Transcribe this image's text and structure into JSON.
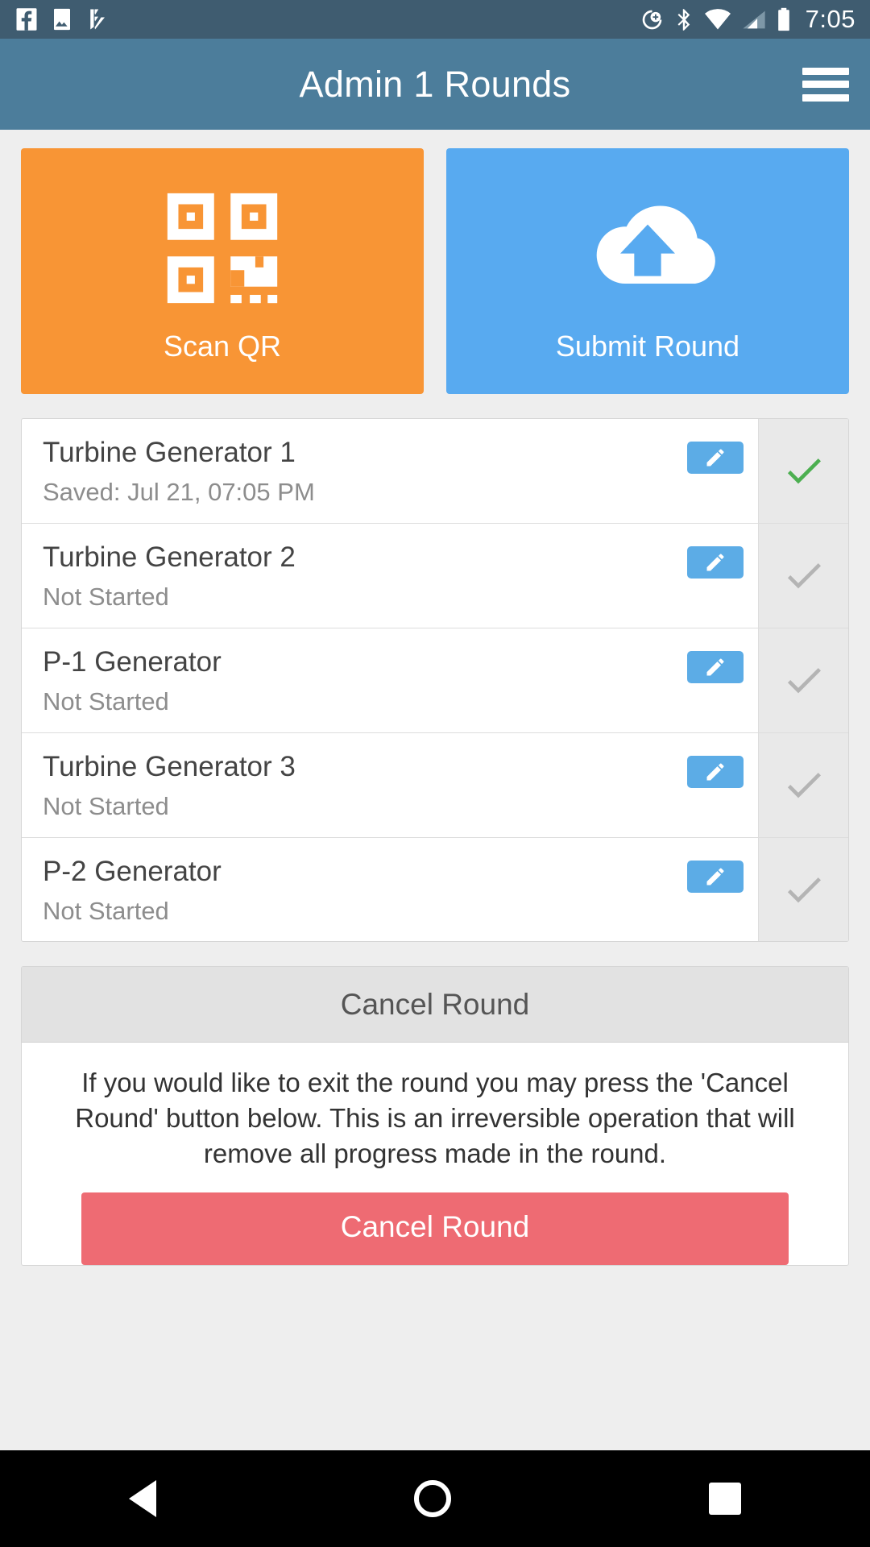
{
  "statusbar": {
    "time": "7:05",
    "left_icons": [
      "facebook-icon",
      "photos-icon",
      "checkmark-app-icon"
    ],
    "right_icons": [
      "location-add-icon",
      "bluetooth-icon",
      "wifi-icon",
      "cellular-signal-icon",
      "battery-icon"
    ],
    "bg_color": "#3f5c70"
  },
  "appbar": {
    "title": "Admin 1 Rounds",
    "menu_icon": "hamburger-menu-icon",
    "bg_color": "#4c7d9b"
  },
  "tiles": [
    {
      "label": "Scan QR",
      "icon": "qr-code-icon",
      "color": "#f89535"
    },
    {
      "label": "Submit Round",
      "icon": "cloud-upload-icon",
      "color": "#58aaf0"
    }
  ],
  "rounds": {
    "items": [
      {
        "title": "Turbine Generator 1",
        "status": "Saved: Jul 21, 07:05 PM",
        "complete": true
      },
      {
        "title": "Turbine Generator 2",
        "status": "Not Started",
        "complete": false
      },
      {
        "title": "P-1 Generator",
        "status": "Not Started",
        "complete": false
      },
      {
        "title": "Turbine Generator 3",
        "status": "Not Started",
        "complete": false
      },
      {
        "title": "P-2 Generator",
        "status": "Not Started",
        "complete": false
      }
    ],
    "edit_icon": "pencil-edit-icon",
    "check_icon": "checkmark-icon",
    "check_done_color": "#4caf50",
    "check_pending_color": "#b4b4b4"
  },
  "cancel_panel": {
    "heading": "Cancel Round",
    "description": "If you would like to exit the round you may press the 'Cancel Round' button below. This is an irreversible operation that will remove all progress made in the round.",
    "button_label": "Cancel Round",
    "button_color": "#ee6b73"
  },
  "navbar": {
    "back": "back-nav-button",
    "home": "home-nav-button",
    "recents": "recents-nav-button"
  }
}
